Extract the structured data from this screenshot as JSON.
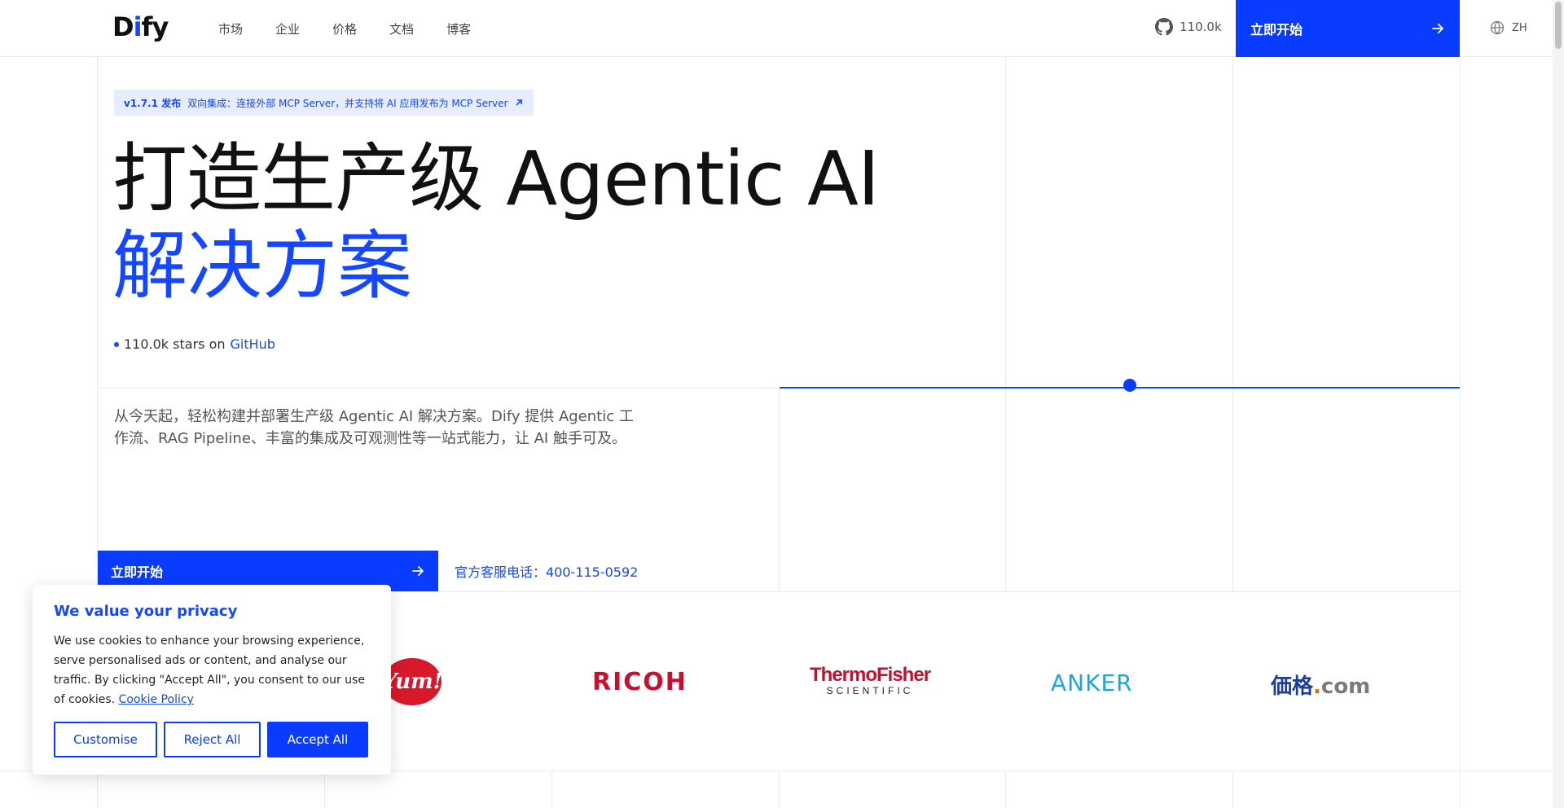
{
  "header": {
    "logo_d": "D",
    "logo_i": "i",
    "logo_fy": "fy",
    "nav": [
      "市场",
      "企业",
      "价格",
      "文档",
      "博客"
    ],
    "github_stars": "110.0k",
    "cta_label": "立即开始",
    "lang_label": "ZH"
  },
  "release": {
    "version": "v1.7.1 发布",
    "text": "双向集成：连接外部 MCP Server，并支持将 AI 应用发布为 MCP Server"
  },
  "hero": {
    "title_line1": "打造生产级 Agentic AI",
    "title_line2": "解决方案",
    "stars_count": "110.0k stars on",
    "stars_link": "GitHub",
    "description": "从今天起，轻松构建并部署生产级 Agentic AI 解决方案。Dify 提供 Agentic 工作流、RAG Pipeline、丰富的集成及可观测性等一站式能力，让 AI 触手可及。",
    "cta_label": "立即开始",
    "phone": "官方客服电话：400-115-0592"
  },
  "logos": {
    "yum": "Yum!",
    "ricoh": "RICOH",
    "thermo_1": "ThermoFisher",
    "thermo_2": "SCIENTIFIC",
    "anker": "ANKER",
    "jiage_main": "価格",
    "jiage_dot": ".",
    "jiage_com": "com"
  },
  "cookie": {
    "title": "We value your privacy",
    "body": "We use cookies to enhance your browsing experience, serve personalised ads or content, and analyse our traffic. By clicking \"Accept All\", you consent to our use of cookies.",
    "policy_link": "Cookie Policy",
    "customise": "Customise",
    "reject": "Reject All",
    "accept": "Accept All"
  },
  "colors": {
    "brand_blue": "#0a3cff",
    "accent_blue": "#1447ff"
  }
}
